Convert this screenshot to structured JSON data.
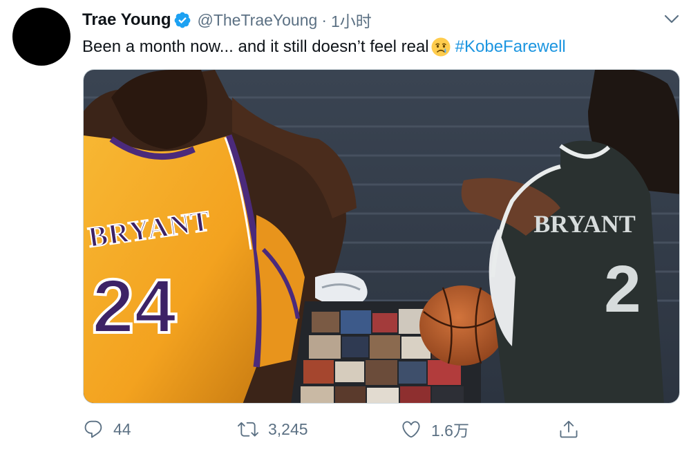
{
  "tweet": {
    "display_name": "Trae Young",
    "handle": "@TheTraeYoung",
    "separator": "·",
    "time": "1小时",
    "text": "Been a month now... and it still doesn’t feel real",
    "emoji": "crying-face",
    "hashtag": "#KobeFarewell",
    "media": {
      "left_jersey_name": "BRYANT",
      "left_jersey_number": "24",
      "right_jersey_name": "BRYANT",
      "right_jersey_number": "2"
    }
  },
  "actions": {
    "reply_count": "44",
    "retweet_count": "3,245",
    "like_count": "1.6万"
  },
  "colors": {
    "link": "#1b95e0",
    "secondary_text": "#5b7083",
    "verified": "#1da1f2"
  },
  "icons": [
    "verified-badge-icon",
    "chevron-down-icon",
    "crying-face-emoji",
    "reply-icon",
    "retweet-icon",
    "like-icon",
    "share-icon"
  ]
}
